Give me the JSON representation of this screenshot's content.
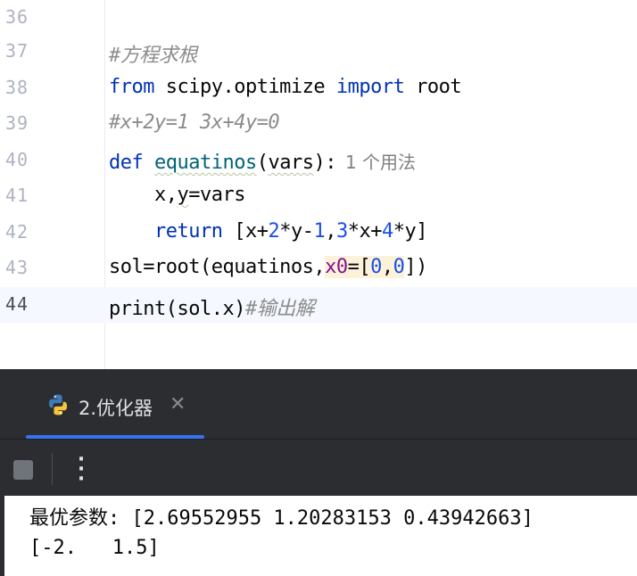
{
  "editor": {
    "lines": [
      {
        "number": "36"
      },
      {
        "number": "37",
        "comment": "#方程求根"
      },
      {
        "number": "38",
        "kw_from": "from",
        "module": " scipy.optimize ",
        "kw_import": "import",
        "name": " root"
      },
      {
        "number": "39",
        "comment": "#x+2y=1 3x+4y=0"
      },
      {
        "number": "40",
        "kw_def": "def",
        "fn_name": "equatinos",
        "open": "(",
        "param": "vars",
        "close": "):",
        "hint": "1 个用法"
      },
      {
        "number": "41",
        "indent": "    ",
        "text_a": "x,",
        "text_b": "y",
        "text_c": "=vars"
      },
      {
        "number": "42",
        "indent": "    ",
        "kw_return": "return",
        "t1": " [x+",
        "n1": "2",
        "t2": "*y-",
        "n2": "1",
        "t3": ",",
        "n3": "3",
        "t4": "*x+",
        "n4": "4",
        "t5": "*y]"
      },
      {
        "number": "43",
        "t1": "sol=root(equatinos,",
        "param": "x0",
        "t2": "=[",
        "n1": "0",
        "t3": ",",
        "n2": "0",
        "t4": "])"
      },
      {
        "number": "44",
        "code": "print(sol.x)",
        "comment": "#输出解"
      }
    ]
  },
  "run_panel": {
    "tab_title": "2.优化器",
    "close_icon": "close-icon",
    "python_icon": "python-icon",
    "stop_icon": "stop-icon",
    "more_icon": "more-vertical-icon",
    "accent": "#3574f0"
  },
  "console": {
    "lines": [
      "最优参数: [2.69552955 1.20283153 0.43942663]",
      "[-2.   1.5]"
    ]
  }
}
